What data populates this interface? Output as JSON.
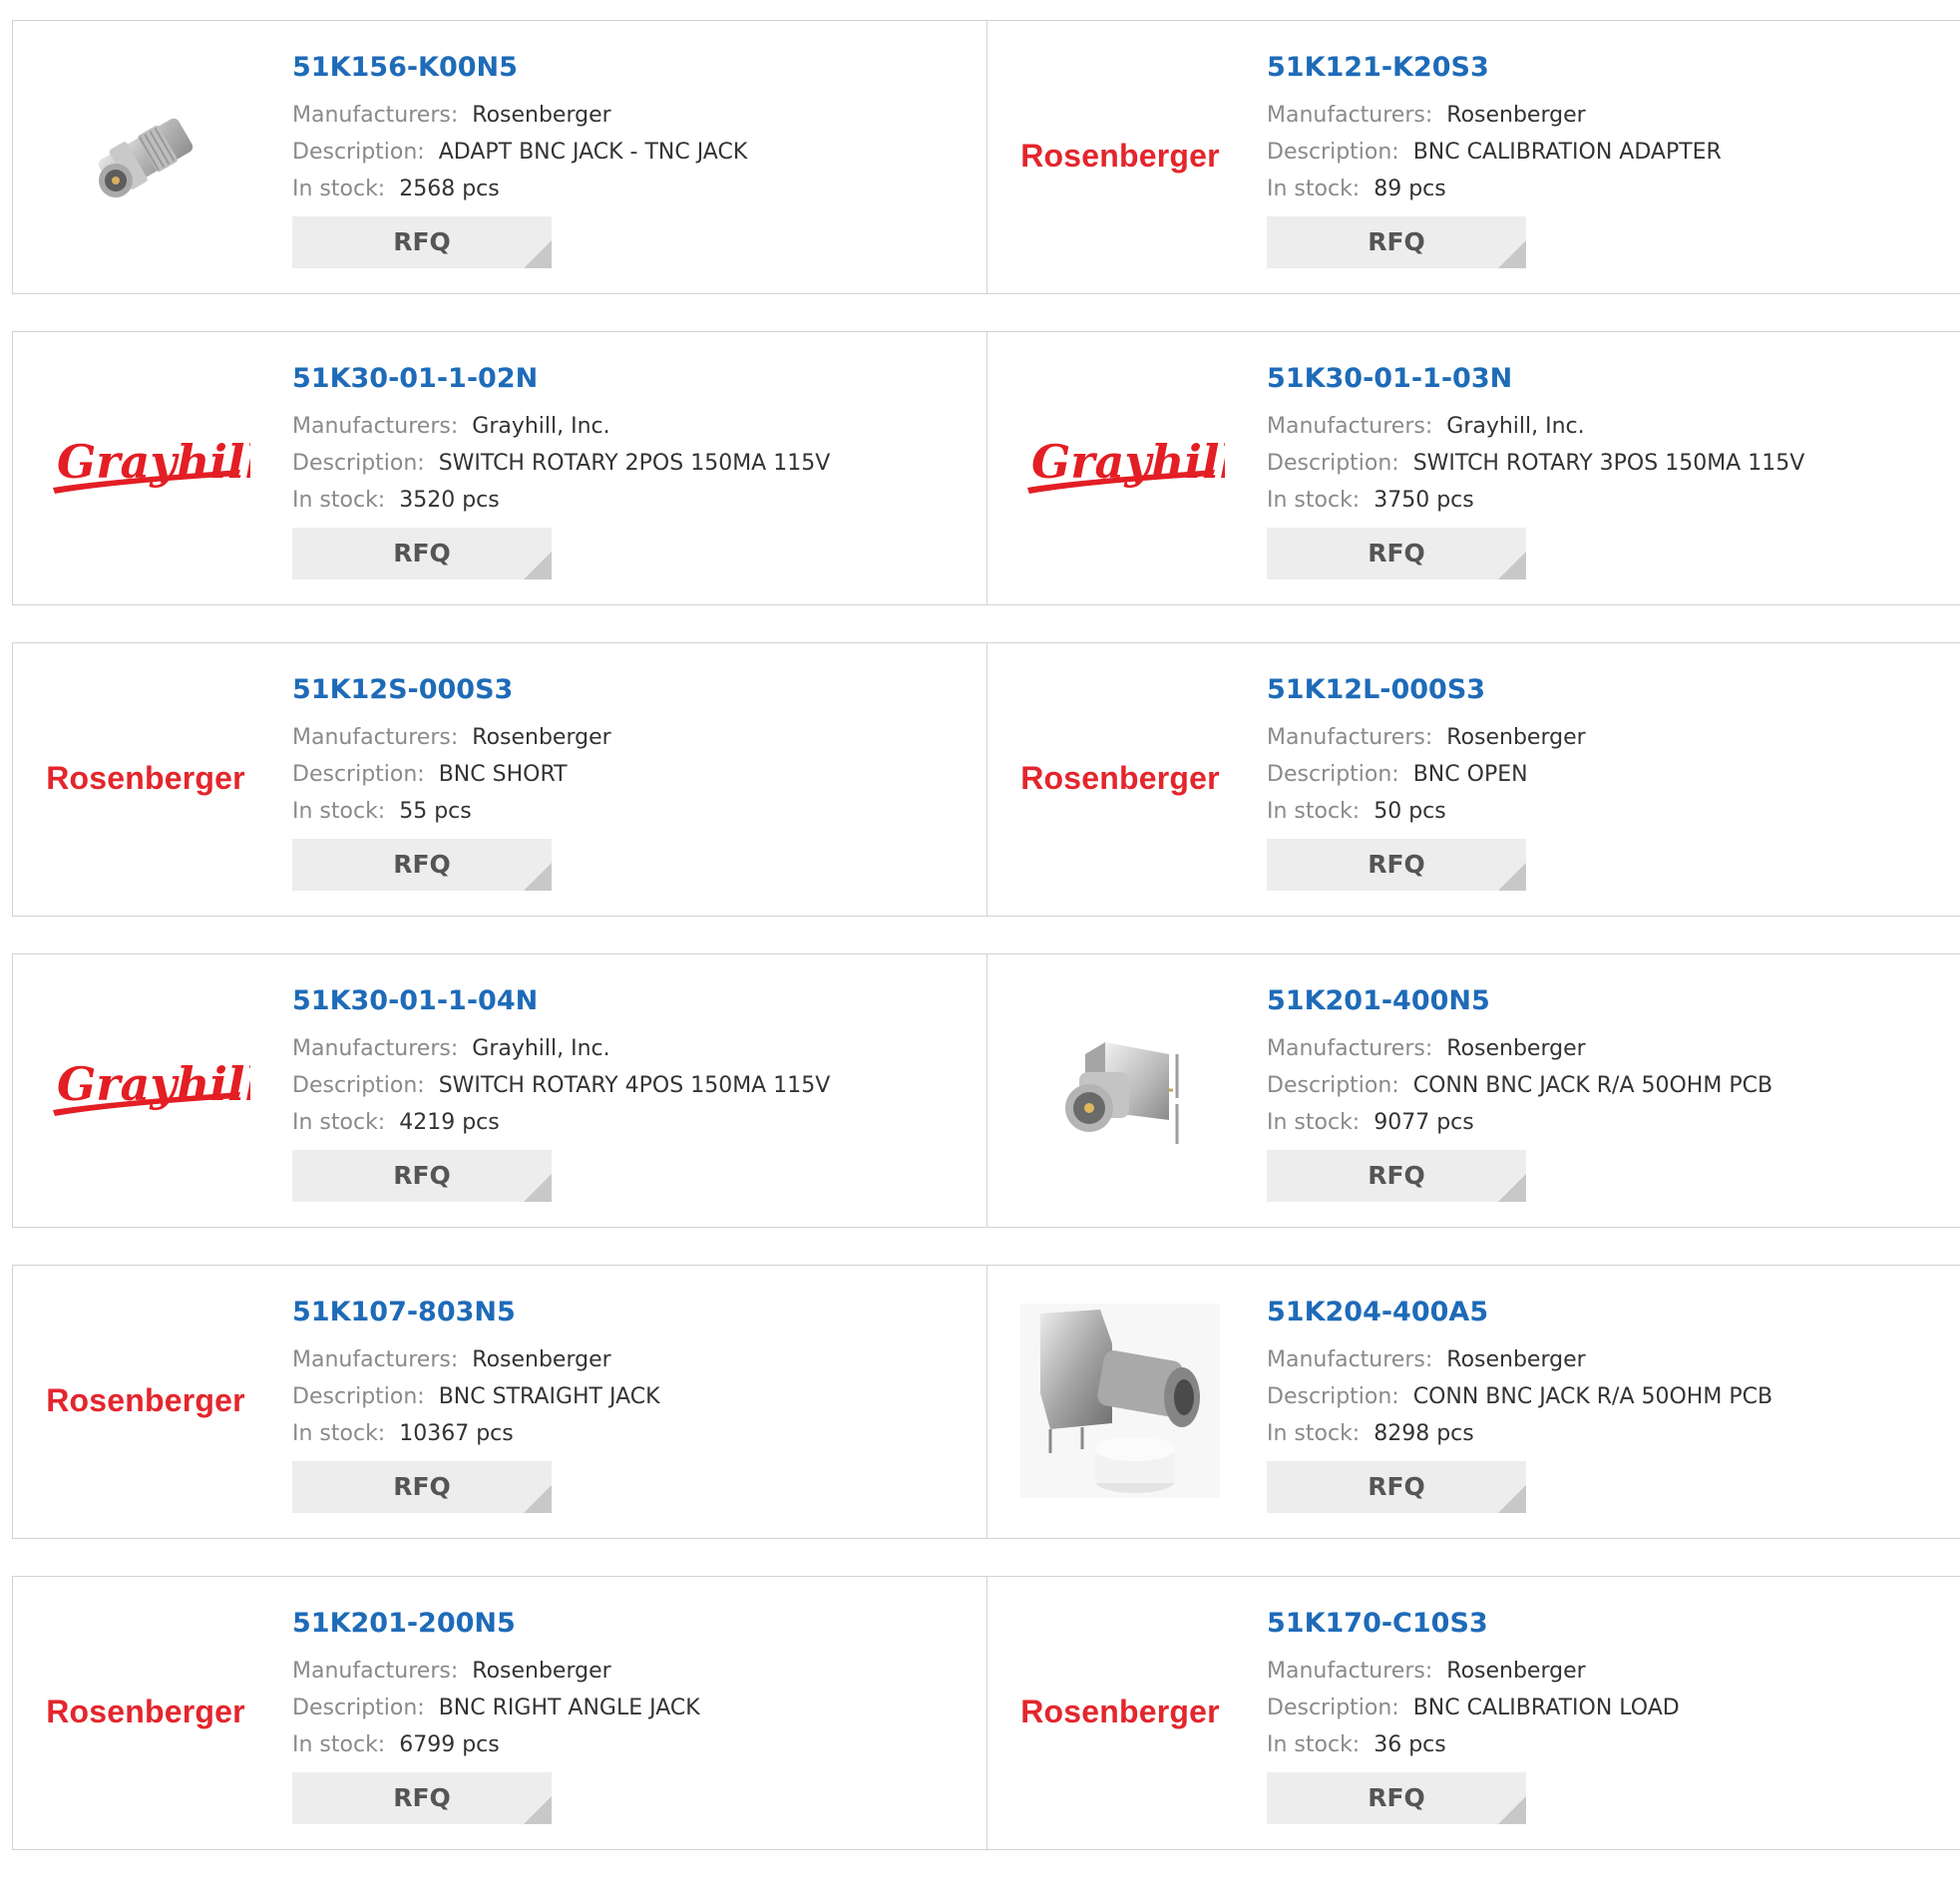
{
  "colors": {
    "part_link": "#1e6bb8",
    "label": "#8a8a8a",
    "value": "#333333",
    "rfq_bg": "#ededed",
    "rosenberger_red": "#e3262c",
    "grayhill_red": "#e31e24"
  },
  "labels": {
    "manufacturers": "Manufacturers:",
    "description": "Description:",
    "in_stock": "In stock:",
    "rfq": "RFQ"
  },
  "products": [
    {
      "part": "51K156-K00N5",
      "manufacturer": "Rosenberger",
      "description": "ADAPT BNC JACK - TNC JACK",
      "stock": "2568 pcs",
      "image": "photo-tnc-adapter",
      "logo_text": ""
    },
    {
      "part": "51K121-K20S3",
      "manufacturer": "Rosenberger",
      "description": "BNC CALIBRATION ADAPTER",
      "stock": "89 pcs",
      "image": "logo-rosenberger",
      "logo_text": "Rosenberger"
    },
    {
      "part": "51K30-01-1-02N",
      "manufacturer": "Grayhill, Inc.",
      "description": "SWITCH ROTARY 2POS 150MA 115V",
      "stock": "3520 pcs",
      "image": "logo-grayhill",
      "logo_text": "Grayhill"
    },
    {
      "part": "51K30-01-1-03N",
      "manufacturer": "Grayhill, Inc.",
      "description": "SWITCH ROTARY 3POS 150MA 115V",
      "stock": "3750 pcs",
      "image": "logo-grayhill",
      "logo_text": "Grayhill"
    },
    {
      "part": "51K12S-000S3",
      "manufacturer": "Rosenberger",
      "description": "BNC SHORT",
      "stock": "55 pcs",
      "image": "logo-rosenberger",
      "logo_text": "Rosenberger"
    },
    {
      "part": "51K12L-000S3",
      "manufacturer": "Rosenberger",
      "description": "BNC OPEN",
      "stock": "50 pcs",
      "image": "logo-rosenberger",
      "logo_text": "Rosenberger"
    },
    {
      "part": "51K30-01-1-04N",
      "manufacturer": "Grayhill, Inc.",
      "description": "SWITCH ROTARY 4POS 150MA 115V",
      "stock": "4219 pcs",
      "image": "logo-grayhill",
      "logo_text": "Grayhill"
    },
    {
      "part": "51K201-400N5",
      "manufacturer": "Rosenberger",
      "description": "CONN BNC JACK R/A 50OHM PCB",
      "stock": "9077 pcs",
      "image": "photo-bnc-ra-pcb",
      "logo_text": ""
    },
    {
      "part": "51K107-803N5",
      "manufacturer": "Rosenberger",
      "description": "BNC STRAIGHT JACK",
      "stock": "10367 pcs",
      "image": "logo-rosenberger",
      "logo_text": "Rosenberger"
    },
    {
      "part": "51K204-400A5",
      "manufacturer": "Rosenberger",
      "description": "CONN BNC JACK R/A 50OHM PCB",
      "stock": "8298 pcs",
      "image": "photo-bnc-ra-cap",
      "logo_text": ""
    },
    {
      "part": "51K201-200N5",
      "manufacturer": "Rosenberger",
      "description": "BNC RIGHT ANGLE JACK",
      "stock": "6799 pcs",
      "image": "logo-rosenberger",
      "logo_text": "Rosenberger"
    },
    {
      "part": "51K170-C10S3",
      "manufacturer": "Rosenberger",
      "description": "BNC CALIBRATION LOAD",
      "stock": "36 pcs",
      "image": "logo-rosenberger",
      "logo_text": "Rosenberger"
    }
  ]
}
